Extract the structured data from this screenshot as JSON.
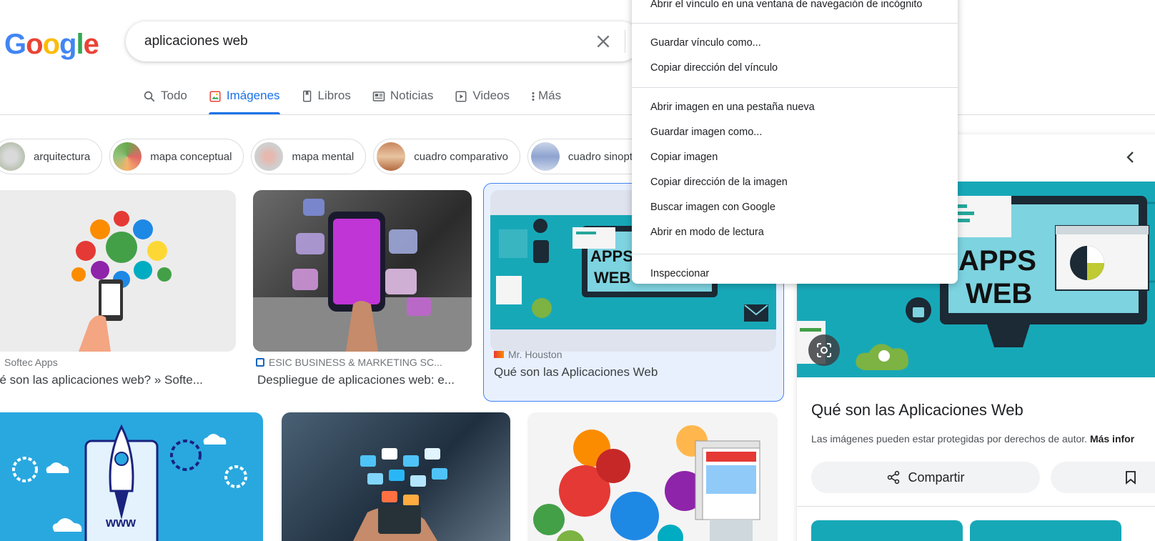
{
  "logo": [
    "G",
    "o",
    "o",
    "g",
    "l",
    "e"
  ],
  "search": {
    "query": "aplicaciones web"
  },
  "tabs": [
    {
      "label": "Todo",
      "icon": "search-icon"
    },
    {
      "label": "Imágenes",
      "icon": "images-icon",
      "active": true
    },
    {
      "label": "Libros",
      "icon": "book-icon"
    },
    {
      "label": "Noticias",
      "icon": "news-icon"
    },
    {
      "label": "Videos",
      "icon": "play-icon"
    },
    {
      "label": "Más",
      "icon": "more-vert-icon"
    }
  ],
  "chips": [
    "arquitectura",
    "mapa conceptual",
    "mapa mental",
    "cuadro comparativo",
    "cuadro sinoptico"
  ],
  "results": [
    {
      "source": "Softec Apps",
      "title": "ué son las aplicaciones web? » Softe..."
    },
    {
      "source": "ESIC BUSINESS & MARKETING SC...",
      "title": "Despliegue de aplicaciones web: e..."
    },
    {
      "source": "Mr. Houston",
      "title": "Qué son las Aplicaciones Web"
    }
  ],
  "result_image_text": {
    "apps": "APPS",
    "web": "WEB",
    "www": "www"
  },
  "panel": {
    "title": "Qué son las Aplicaciones Web",
    "note": "Las imágenes pueden estar protegidas por derechos de autor.",
    "note_link": "Más infor",
    "share_label": "Compartir"
  },
  "context_menu": {
    "items": [
      "Abrir el vínculo en una ventana de navegación de incógnito",
      "Guardar vínculo como...",
      "Copiar dirección del vínculo",
      "Abrir imagen en una pestaña nueva",
      "Guardar imagen como...",
      "Copiar imagen",
      "Copiar dirección de la imagen",
      "Buscar imagen con Google",
      "Abrir en modo de lectura",
      "Inspeccionar"
    ]
  },
  "colors": {
    "accent": "#1a73e8",
    "teal": "#17a8b8",
    "selected_bg": "#e8f0fe"
  }
}
